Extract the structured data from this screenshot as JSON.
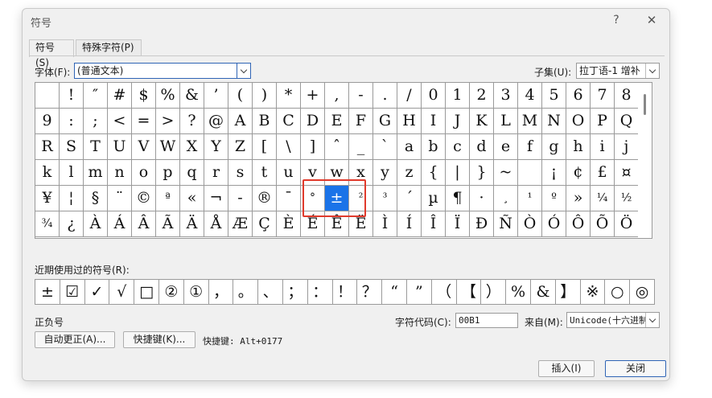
{
  "dialog": {
    "title": "符号",
    "help": "?",
    "close": "✕"
  },
  "tabs": [
    {
      "label": "符号(S)"
    },
    {
      "label": "特殊字符(P)"
    }
  ],
  "font": {
    "label": "字体(F):",
    "value": "(普通文本)"
  },
  "subset": {
    "label": "子集(U):",
    "value": "拉丁语-1 增补"
  },
  "symbols": [
    "",
    "!",
    "″",
    "#",
    "$",
    "%",
    "&",
    "’",
    "(",
    ")",
    "*",
    "+",
    ",",
    "-",
    ".",
    "/",
    "0",
    "1",
    "2",
    "3",
    "4",
    "5",
    "6",
    "7",
    "8",
    "9",
    ":",
    ";",
    "<",
    "=",
    ">",
    "?",
    "@",
    "A",
    "B",
    "C",
    "D",
    "E",
    "F",
    "G",
    "H",
    "I",
    "J",
    "K",
    "L",
    "M",
    "N",
    "O",
    "P",
    "Q",
    "R",
    "S",
    "T",
    "U",
    "V",
    "W",
    "X",
    "Y",
    "Z",
    "[",
    "\\",
    "]",
    "ˆ",
    "_",
    "`",
    "a",
    "b",
    "c",
    "d",
    "e",
    "f",
    "g",
    "h",
    "i",
    "j",
    "k",
    "l",
    "m",
    "n",
    "o",
    "p",
    "q",
    "r",
    "s",
    "t",
    "u",
    "v",
    "w",
    "x",
    "y",
    "z",
    "{",
    "|",
    "}",
    "~",
    "",
    "¡",
    "¢",
    "£",
    "¤",
    "¥",
    "¦",
    "§",
    "¨",
    "©",
    "ª",
    "«",
    "¬",
    "-",
    "®",
    "¯",
    "°",
    "±",
    "²",
    "³",
    "´",
    "µ",
    "¶",
    "·",
    "¸",
    "¹",
    "º",
    "»",
    "¼",
    "½",
    "¾",
    "¿",
    "À",
    "Á",
    "Â",
    "Ã",
    "Ä",
    "Å",
    "Æ",
    "Ç",
    "È",
    "É",
    "Ê",
    "Ë",
    "Ì",
    "Í",
    "Î",
    "Ï",
    "Ð",
    "Ñ",
    "Ò",
    "Ó",
    "Ô",
    "Õ",
    "Ö"
  ],
  "selected_symbol": "±",
  "recent": {
    "label": "近期使用过的符号(R):",
    "symbols": [
      "±",
      "☑",
      "✓",
      "√",
      "□",
      "②",
      "①",
      "，",
      "。",
      "、",
      "；",
      "：",
      "！",
      "？",
      "“",
      "”",
      "（",
      "【",
      "）",
      "%",
      "&",
      "】",
      "※",
      "○",
      "◎"
    ]
  },
  "char_name": "正负号",
  "char_code": {
    "label": "字符代码(C):",
    "value": "00B1"
  },
  "from": {
    "label": "来自(M):",
    "value": "Unicode(十六进制)"
  },
  "buttons": {
    "autocorrect": "自动更正(A)...",
    "shortcut_key": "快捷键(K)...",
    "shortcut_text": "快捷键: Alt+0177",
    "insert": "插入(I)",
    "close": "关闭"
  },
  "colors": {
    "selection": "#1a73e8",
    "highlight_box": "#e03a2c"
  }
}
